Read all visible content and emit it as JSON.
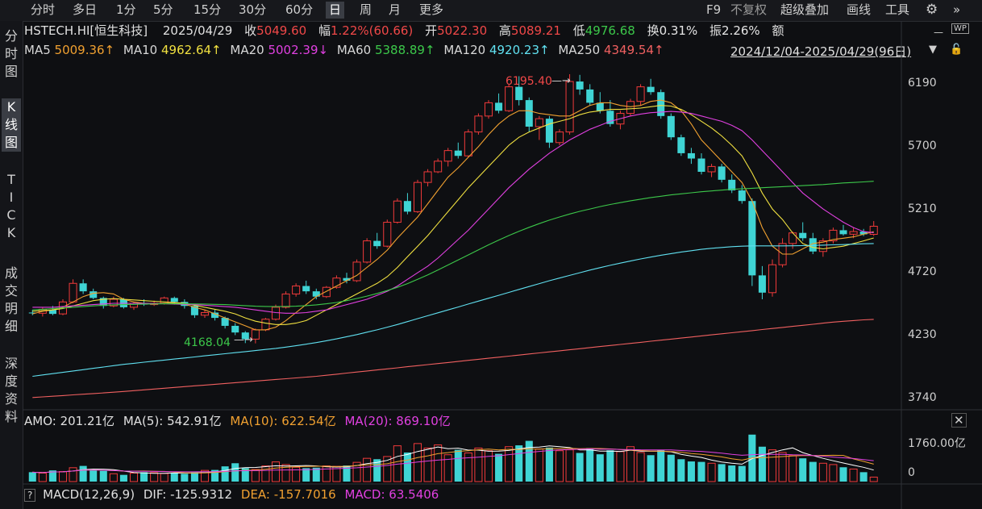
{
  "toolbar": {
    "periods": [
      "分时",
      "多日",
      "1分",
      "5分",
      "15分",
      "30分",
      "60分",
      "日",
      "周",
      "月",
      "更多"
    ],
    "selected_period": "日",
    "right_tools": {
      "f9": "F9",
      "adjust": "不复权",
      "overlay": "超级叠加",
      "draw": "画线",
      "tools": "工具"
    }
  },
  "sidebar": {
    "tabs": [
      "分\n时\n图",
      "K\n线\n图",
      "T\nI\nC\nK",
      "成\n交\n明\n细",
      "深\n度\n资\n料"
    ],
    "selected": "K\n线\n图"
  },
  "quote": {
    "symbol": "HSTECH.HI[恒生科技]",
    "date": "2025/04/29",
    "close_label": "收",
    "close": "5049.60",
    "change_label": "幅",
    "change": "1.22%(60.66)",
    "open_label": "开",
    "open": "5022.30",
    "high_label": "高",
    "high": "5089.21",
    "low_label": "低",
    "low": "4976.68",
    "turnover_label": "换",
    "turnover": "0.31%",
    "amplitude_label": "振",
    "amplitude": "2.26%",
    "amount_label": "额"
  },
  "ma_legend": [
    {
      "name": "MA5",
      "value": "5009.36↑",
      "color": "#f0a030"
    },
    {
      "name": "MA10",
      "value": "4962.64↑",
      "color": "#f0e040"
    },
    {
      "name": "MA20",
      "value": "5002.39↓",
      "color": "#e040e0"
    },
    {
      "name": "MA60",
      "value": "5388.89↑",
      "color": "#3cc84a"
    },
    {
      "name": "MA120",
      "value": "4920.23↑",
      "color": "#60e0f0"
    },
    {
      "name": "MA250",
      "value": "4349.54↑",
      "color": "#f06060"
    }
  ],
  "range": "2024/12/04-2025/04/29(96日)",
  "colors": {
    "up": "#f03a3a",
    "down": "#3fd4d4",
    "grid": "#2a2c31"
  },
  "chart_data": {
    "type": "candlestick",
    "yticks": [
      "6190",
      "5700",
      "5210",
      "4720",
      "4230",
      "3740"
    ],
    "ylim": [
      3680,
      6280
    ],
    "annotations": [
      {
        "label": "6195.40",
        "kind": "high"
      },
      {
        "label": "4168.04",
        "kind": "low"
      }
    ],
    "candles": [
      [
        4400,
        4420,
        4380,
        4395
      ],
      [
        4395,
        4440,
        4370,
        4425
      ],
      [
        4420,
        4450,
        4380,
        4390
      ],
      [
        4390,
        4500,
        4380,
        4480
      ],
      [
        4480,
        4650,
        4470,
        4620
      ],
      [
        4620,
        4650,
        4540,
        4560
      ],
      [
        4560,
        4580,
        4500,
        4510
      ],
      [
        4510,
        4520,
        4430,
        4450
      ],
      [
        4450,
        4520,
        4440,
        4500
      ],
      [
        4500,
        4510,
        4430,
        4440
      ],
      [
        4440,
        4480,
        4420,
        4470
      ],
      [
        4470,
        4500,
        4450,
        4460
      ],
      [
        4460,
        4490,
        4450,
        4470
      ],
      [
        4470,
        4520,
        4460,
        4510
      ],
      [
        4510,
        4520,
        4460,
        4480
      ],
      [
        4480,
        4500,
        4430,
        4450
      ],
      [
        4450,
        4460,
        4360,
        4380
      ],
      [
        4380,
        4420,
        4360,
        4400
      ],
      [
        4400,
        4420,
        4340,
        4360
      ],
      [
        4360,
        4370,
        4280,
        4300
      ],
      [
        4300,
        4320,
        4230,
        4250
      ],
      [
        4250,
        4260,
        4170,
        4200
      ],
      [
        4200,
        4280,
        4168,
        4270
      ],
      [
        4270,
        4360,
        4260,
        4350
      ],
      [
        4350,
        4460,
        4340,
        4440
      ],
      [
        4440,
        4560,
        4430,
        4540
      ],
      [
        4540,
        4620,
        4520,
        4600
      ],
      [
        4600,
        4640,
        4540,
        4560
      ],
      [
        4560,
        4580,
        4500,
        4520
      ],
      [
        4520,
        4600,
        4510,
        4590
      ],
      [
        4590,
        4680,
        4580,
        4660
      ],
      [
        4660,
        4700,
        4620,
        4640
      ],
      [
        4640,
        4800,
        4630,
        4780
      ],
      [
        4780,
        4960,
        4770,
        4940
      ],
      [
        4940,
        5000,
        4880,
        4900
      ],
      [
        4900,
        5100,
        4890,
        5080
      ],
      [
        5080,
        5260,
        5070,
        5240
      ],
      [
        5240,
        5300,
        5140,
        5160
      ],
      [
        5160,
        5400,
        5150,
        5380
      ],
      [
        5380,
        5480,
        5350,
        5460
      ],
      [
        5460,
        5560,
        5450,
        5540
      ],
      [
        5540,
        5640,
        5500,
        5620
      ],
      [
        5620,
        5680,
        5560,
        5580
      ],
      [
        5580,
        5780,
        5570,
        5760
      ],
      [
        5760,
        5900,
        5740,
        5880
      ],
      [
        5880,
        6000,
        5860,
        5980
      ],
      [
        5980,
        6050,
        5900,
        5920
      ],
      [
        5920,
        6120,
        5910,
        6100
      ],
      [
        6100,
        6180,
        5960,
        6000
      ],
      [
        6000,
        6020,
        5760,
        5800
      ],
      [
        5800,
        5880,
        5700,
        5860
      ],
      [
        5860,
        5880,
        5640,
        5680
      ],
      [
        5680,
        5780,
        5660,
        5760
      ],
      [
        5760,
        6195,
        5740,
        6140
      ],
      [
        6140,
        6190,
        6040,
        6080
      ],
      [
        6080,
        6120,
        5960,
        5980
      ],
      [
        5980,
        6060,
        5900,
        5920
      ],
      [
        5920,
        6000,
        5800,
        5820
      ],
      [
        5820,
        5920,
        5780,
        5900
      ],
      [
        5900,
        6010,
        5880,
        5990
      ],
      [
        5990,
        6120,
        5960,
        6100
      ],
      [
        6100,
        6160,
        6040,
        6060
      ],
      [
        6060,
        6080,
        5860,
        5880
      ],
      [
        5880,
        5900,
        5700,
        5720
      ],
      [
        5720,
        5740,
        5580,
        5600
      ],
      [
        5600,
        5640,
        5520,
        5560
      ],
      [
        5560,
        5600,
        5440,
        5460
      ],
      [
        5460,
        5520,
        5420,
        5500
      ],
      [
        5500,
        5520,
        5380,
        5400
      ],
      [
        5400,
        5440,
        5300,
        5320
      ],
      [
        5320,
        5360,
        5220,
        5240
      ],
      [
        5240,
        5260,
        4600,
        4680
      ],
      [
        4680,
        4750,
        4500,
        4550
      ],
      [
        4550,
        4800,
        4520,
        4760
      ],
      [
        4760,
        4960,
        4740,
        4920
      ],
      [
        4920,
        5010,
        4880,
        5000
      ],
      [
        5000,
        5080,
        4940,
        4960
      ],
      [
        4960,
        5000,
        4840,
        4860
      ],
      [
        4860,
        4960,
        4820,
        4940
      ],
      [
        4940,
        5040,
        4920,
        5020
      ],
      [
        5020,
        5060,
        4980,
        4990
      ],
      [
        4990,
        5040,
        4960,
        5010
      ],
      [
        5010,
        5030,
        4976,
        4989
      ],
      [
        4989,
        5089,
        4977,
        5050
      ]
    ],
    "ma_series": [
      {
        "name": "MA5",
        "color": "#f0a030",
        "values": [
          4390,
          4410,
          4420,
          4440,
          4480,
          4520,
          4545,
          4550,
          4540,
          4500,
          4480,
          4470,
          4465,
          4470,
          4470,
          4465,
          4440,
          4420,
          4390,
          4360,
          4330,
          4300,
          4270,
          4270,
          4290,
          4340,
          4400,
          4460,
          4520,
          4560,
          4600,
          4640,
          4680,
          4740,
          4800,
          4870,
          4960,
          5040,
          5120,
          5220,
          5320,
          5420,
          5490,
          5570,
          5650,
          5740,
          5820,
          5880,
          5920,
          5920,
          5900,
          5890,
          5880,
          5880,
          5920,
          5960,
          5980,
          5980,
          5960,
          5950,
          5960,
          5990,
          6000,
          5980,
          5920,
          5820,
          5700,
          5620,
          5540,
          5460,
          5380,
          5240,
          5040,
          4900,
          4840,
          4840,
          4880,
          4920,
          4930,
          4950,
          4960,
          4970,
          4990,
          5009
        ]
      },
      {
        "name": "MA10",
        "color": "#f0e040",
        "values": [
          4410,
          4415,
          4420,
          4430,
          4450,
          4470,
          4490,
          4500,
          4505,
          4500,
          4495,
          4490,
          4485,
          4480,
          4475,
          4470,
          4455,
          4440,
          4425,
          4410,
          4390,
          4360,
          4335,
          4320,
          4310,
          4310,
          4320,
          4340,
          4380,
          4420,
          4460,
          4500,
          4540,
          4580,
          4620,
          4670,
          4740,
          4820,
          4900,
          4980,
          5070,
          5160,
          5250,
          5340,
          5420,
          5500,
          5580,
          5660,
          5720,
          5760,
          5790,
          5820,
          5840,
          5860,
          5890,
          5910,
          5920,
          5930,
          5930,
          5935,
          5940,
          5950,
          5960,
          5955,
          5930,
          5890,
          5840,
          5790,
          5730,
          5660,
          5580,
          5450,
          5300,
          5180,
          5100,
          5000,
          4920,
          4890,
          4880,
          4890,
          4900,
          4920,
          4940,
          4962
        ]
      },
      {
        "name": "MA20",
        "color": "#e040e0",
        "values": [
          4440,
          4440,
          4440,
          4445,
          4450,
          4455,
          4460,
          4465,
          4470,
          4470,
          4470,
          4470,
          4468,
          4466,
          4464,
          4462,
          4460,
          4455,
          4450,
          4445,
          4440,
          4430,
          4420,
          4410,
          4400,
          4395,
          4395,
          4400,
          4410,
          4420,
          4440,
          4460,
          4480,
          4500,
          4530,
          4560,
          4600,
          4650,
          4700,
          4750,
          4810,
          4880,
          4950,
          5020,
          5100,
          5180,
          5260,
          5340,
          5410,
          5480,
          5540,
          5600,
          5650,
          5700,
          5740,
          5780,
          5810,
          5840,
          5860,
          5880,
          5895,
          5905,
          5910,
          5915,
          5910,
          5900,
          5880,
          5860,
          5840,
          5810,
          5770,
          5700,
          5620,
          5540,
          5460,
          5380,
          5300,
          5240,
          5180,
          5130,
          5080,
          5040,
          5010,
          5002
        ]
      },
      {
        "name": "MA60",
        "color": "#3cc84a",
        "values": [
          4420,
          4425,
          4430,
          4435,
          4440,
          4445,
          4450,
          4455,
          4458,
          4460,
          4462,
          4464,
          4465,
          4466,
          4466,
          4466,
          4465,
          4464,
          4462,
          4460,
          4456,
          4452,
          4448,
          4446,
          4445,
          4446,
          4448,
          4452,
          4458,
          4466,
          4476,
          4490,
          4506,
          4524,
          4544,
          4566,
          4590,
          4618,
          4650,
          4684,
          4720,
          4758,
          4796,
          4834,
          4872,
          4910,
          4946,
          4980,
          5012,
          5042,
          5070,
          5096,
          5120,
          5142,
          5162,
          5180,
          5198,
          5214,
          5228,
          5242,
          5254,
          5266,
          5276,
          5286,
          5294,
          5302,
          5310,
          5316,
          5322,
          5328,
          5332,
          5336,
          5340,
          5344,
          5348,
          5352,
          5356,
          5360,
          5364,
          5370,
          5376,
          5380,
          5384,
          5389
        ]
      },
      {
        "name": "MA120",
        "color": "#60e0f0",
        "values": [
          3920,
          3930,
          3940,
          3950,
          3960,
          3970,
          3980,
          3990,
          4000,
          4010,
          4018,
          4026,
          4034,
          4042,
          4050,
          4058,
          4066,
          4074,
          4082,
          4090,
          4098,
          4106,
          4114,
          4122,
          4130,
          4140,
          4150,
          4162,
          4174,
          4188,
          4202,
          4218,
          4234,
          4252,
          4270,
          4290,
          4310,
          4332,
          4354,
          4376,
          4398,
          4420,
          4442,
          4464,
          4486,
          4508,
          4530,
          4552,
          4574,
          4596,
          4618,
          4640,
          4660,
          4680,
          4700,
          4720,
          4738,
          4756,
          4772,
          4788,
          4804,
          4818,
          4832,
          4844,
          4856,
          4866,
          4876,
          4884,
          4890,
          4896,
          4900,
          4902,
          4902,
          4902,
          4902,
          4903,
          4904,
          4906,
          4908,
          4910,
          4912,
          4915,
          4918,
          4920
        ]
      },
      {
        "name": "MA250",
        "color": "#f06060",
        "values": [
          3760,
          3765,
          3770,
          3775,
          3780,
          3785,
          3790,
          3795,
          3800,
          3806,
          3812,
          3818,
          3824,
          3830,
          3836,
          3842,
          3848,
          3854,
          3860,
          3866,
          3872,
          3878,
          3884,
          3890,
          3896,
          3902,
          3908,
          3914,
          3920,
          3928,
          3936,
          3944,
          3952,
          3960,
          3968,
          3976,
          3984,
          3992,
          4000,
          4008,
          4016,
          4024,
          4032,
          4040,
          4048,
          4056,
          4064,
          4072,
          4080,
          4088,
          4096,
          4104,
          4112,
          4120,
          4128,
          4136,
          4144,
          4152,
          4160,
          4168,
          4176,
          4184,
          4192,
          4200,
          4208,
          4216,
          4224,
          4232,
          4240,
          4248,
          4256,
          4264,
          4272,
          4280,
          4288,
          4296,
          4304,
          4312,
          4320,
          4328,
          4334,
          4340,
          4345,
          4349
        ]
      }
    ]
  },
  "volume": {
    "label": "AMO: 201.21亿",
    "ma5": "MA(5): 542.91亿",
    "ma10": "MA(10): 622.54亿",
    "ma20": "MA(20): 869.10亿",
    "yticks": [
      "1760.00亿",
      "0"
    ],
    "ylim": [
      0,
      2200
    ],
    "values": [
      420,
      380,
      500,
      450,
      620,
      700,
      520,
      480,
      350,
      300,
      380,
      420,
      400,
      360,
      380,
      350,
      420,
      500,
      520,
      680,
      820,
      600,
      540,
      700,
      880,
      760,
      640,
      600,
      620,
      700,
      680,
      720,
      860,
      1040,
      1000,
      1120,
      1600,
      1300,
      1700,
      1500,
      1640,
      1200,
      1420,
      1280,
      1500,
      1380,
      1240,
      1560,
      1620,
      1820,
      1460,
      1520,
      1380,
      1420,
      1280,
      1500,
      1220,
      1400,
      1340,
      1560,
      1300,
      1180,
      1420,
      1200,
      1000,
      900,
      880,
      820,
      780,
      720,
      700,
      2100,
      1560,
      1420,
      1300,
      1160,
      1040,
      880,
      820,
      760,
      640,
      560,
      420,
      200
    ],
    "ma_colors": [
      "#ffffff",
      "#f0a030",
      "#e040e0"
    ]
  },
  "macd": {
    "title": "MACD(12,26,9)",
    "dif": "DIF: -125.9312",
    "dea": "DEA: -157.7016",
    "macd": "MACD: 63.5406"
  }
}
